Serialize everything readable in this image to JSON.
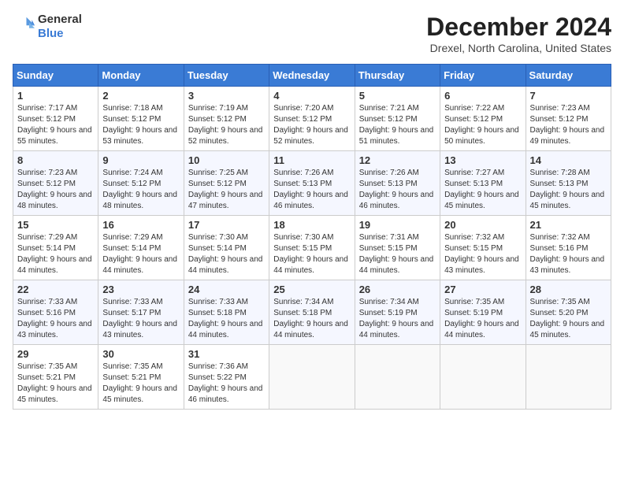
{
  "header": {
    "logo_line1": "General",
    "logo_line2": "Blue",
    "month": "December 2024",
    "location": "Drexel, North Carolina, United States"
  },
  "columns": [
    "Sunday",
    "Monday",
    "Tuesday",
    "Wednesday",
    "Thursday",
    "Friday",
    "Saturday"
  ],
  "weeks": [
    [
      {
        "day": 1,
        "sunrise": "Sunrise: 7:17 AM",
        "sunset": "Sunset: 5:12 PM",
        "daylight": "Daylight: 9 hours and 55 minutes."
      },
      {
        "day": 2,
        "sunrise": "Sunrise: 7:18 AM",
        "sunset": "Sunset: 5:12 PM",
        "daylight": "Daylight: 9 hours and 53 minutes."
      },
      {
        "day": 3,
        "sunrise": "Sunrise: 7:19 AM",
        "sunset": "Sunset: 5:12 PM",
        "daylight": "Daylight: 9 hours and 52 minutes."
      },
      {
        "day": 4,
        "sunrise": "Sunrise: 7:20 AM",
        "sunset": "Sunset: 5:12 PM",
        "daylight": "Daylight: 9 hours and 52 minutes."
      },
      {
        "day": 5,
        "sunrise": "Sunrise: 7:21 AM",
        "sunset": "Sunset: 5:12 PM",
        "daylight": "Daylight: 9 hours and 51 minutes."
      },
      {
        "day": 6,
        "sunrise": "Sunrise: 7:22 AM",
        "sunset": "Sunset: 5:12 PM",
        "daylight": "Daylight: 9 hours and 50 minutes."
      },
      {
        "day": 7,
        "sunrise": "Sunrise: 7:23 AM",
        "sunset": "Sunset: 5:12 PM",
        "daylight": "Daylight: 9 hours and 49 minutes."
      }
    ],
    [
      {
        "day": 8,
        "sunrise": "Sunrise: 7:23 AM",
        "sunset": "Sunset: 5:12 PM",
        "daylight": "Daylight: 9 hours and 48 minutes."
      },
      {
        "day": 9,
        "sunrise": "Sunrise: 7:24 AM",
        "sunset": "Sunset: 5:12 PM",
        "daylight": "Daylight: 9 hours and 48 minutes."
      },
      {
        "day": 10,
        "sunrise": "Sunrise: 7:25 AM",
        "sunset": "Sunset: 5:12 PM",
        "daylight": "Daylight: 9 hours and 47 minutes."
      },
      {
        "day": 11,
        "sunrise": "Sunrise: 7:26 AM",
        "sunset": "Sunset: 5:13 PM",
        "daylight": "Daylight: 9 hours and 46 minutes."
      },
      {
        "day": 12,
        "sunrise": "Sunrise: 7:26 AM",
        "sunset": "Sunset: 5:13 PM",
        "daylight": "Daylight: 9 hours and 46 minutes."
      },
      {
        "day": 13,
        "sunrise": "Sunrise: 7:27 AM",
        "sunset": "Sunset: 5:13 PM",
        "daylight": "Daylight: 9 hours and 45 minutes."
      },
      {
        "day": 14,
        "sunrise": "Sunrise: 7:28 AM",
        "sunset": "Sunset: 5:13 PM",
        "daylight": "Daylight: 9 hours and 45 minutes."
      }
    ],
    [
      {
        "day": 15,
        "sunrise": "Sunrise: 7:29 AM",
        "sunset": "Sunset: 5:14 PM",
        "daylight": "Daylight: 9 hours and 44 minutes."
      },
      {
        "day": 16,
        "sunrise": "Sunrise: 7:29 AM",
        "sunset": "Sunset: 5:14 PM",
        "daylight": "Daylight: 9 hours and 44 minutes."
      },
      {
        "day": 17,
        "sunrise": "Sunrise: 7:30 AM",
        "sunset": "Sunset: 5:14 PM",
        "daylight": "Daylight: 9 hours and 44 minutes."
      },
      {
        "day": 18,
        "sunrise": "Sunrise: 7:30 AM",
        "sunset": "Sunset: 5:15 PM",
        "daylight": "Daylight: 9 hours and 44 minutes."
      },
      {
        "day": 19,
        "sunrise": "Sunrise: 7:31 AM",
        "sunset": "Sunset: 5:15 PM",
        "daylight": "Daylight: 9 hours and 44 minutes."
      },
      {
        "day": 20,
        "sunrise": "Sunrise: 7:32 AM",
        "sunset": "Sunset: 5:15 PM",
        "daylight": "Daylight: 9 hours and 43 minutes."
      },
      {
        "day": 21,
        "sunrise": "Sunrise: 7:32 AM",
        "sunset": "Sunset: 5:16 PM",
        "daylight": "Daylight: 9 hours and 43 minutes."
      }
    ],
    [
      {
        "day": 22,
        "sunrise": "Sunrise: 7:33 AM",
        "sunset": "Sunset: 5:16 PM",
        "daylight": "Daylight: 9 hours and 43 minutes."
      },
      {
        "day": 23,
        "sunrise": "Sunrise: 7:33 AM",
        "sunset": "Sunset: 5:17 PM",
        "daylight": "Daylight: 9 hours and 43 minutes."
      },
      {
        "day": 24,
        "sunrise": "Sunrise: 7:33 AM",
        "sunset": "Sunset: 5:18 PM",
        "daylight": "Daylight: 9 hours and 44 minutes."
      },
      {
        "day": 25,
        "sunrise": "Sunrise: 7:34 AM",
        "sunset": "Sunset: 5:18 PM",
        "daylight": "Daylight: 9 hours and 44 minutes."
      },
      {
        "day": 26,
        "sunrise": "Sunrise: 7:34 AM",
        "sunset": "Sunset: 5:19 PM",
        "daylight": "Daylight: 9 hours and 44 minutes."
      },
      {
        "day": 27,
        "sunrise": "Sunrise: 7:35 AM",
        "sunset": "Sunset: 5:19 PM",
        "daylight": "Daylight: 9 hours and 44 minutes."
      },
      {
        "day": 28,
        "sunrise": "Sunrise: 7:35 AM",
        "sunset": "Sunset: 5:20 PM",
        "daylight": "Daylight: 9 hours and 45 minutes."
      }
    ],
    [
      {
        "day": 29,
        "sunrise": "Sunrise: 7:35 AM",
        "sunset": "Sunset: 5:21 PM",
        "daylight": "Daylight: 9 hours and 45 minutes."
      },
      {
        "day": 30,
        "sunrise": "Sunrise: 7:35 AM",
        "sunset": "Sunset: 5:21 PM",
        "daylight": "Daylight: 9 hours and 45 minutes."
      },
      {
        "day": 31,
        "sunrise": "Sunrise: 7:36 AM",
        "sunset": "Sunset: 5:22 PM",
        "daylight": "Daylight: 9 hours and 46 minutes."
      },
      null,
      null,
      null,
      null
    ]
  ]
}
